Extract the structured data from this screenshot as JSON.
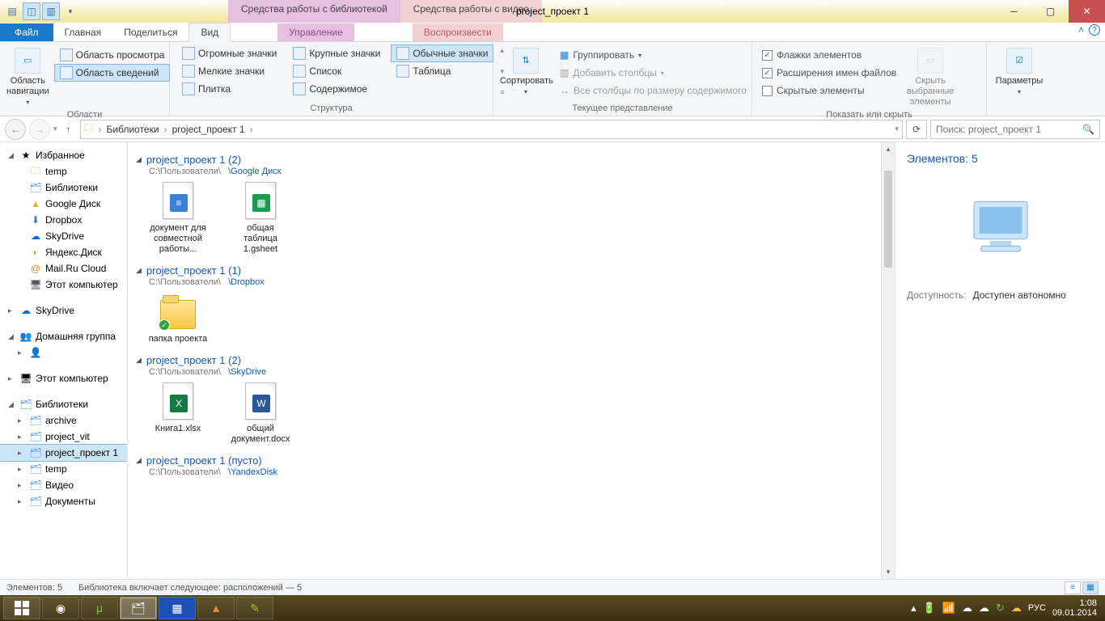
{
  "window": {
    "title": "project_проект 1",
    "ctx_tab1": "Средства работы с библиотекой",
    "ctx_tab2": "Средства работы с видео"
  },
  "ribbon_tabs": {
    "file": "Файл",
    "home": "Главная",
    "share": "Поделиться",
    "view": "Вид",
    "manage": "Управление",
    "play": "Воспроизвести"
  },
  "ribbon": {
    "panes": {
      "nav_pane": "Область навигации",
      "preview": "Область просмотра",
      "details": "Область сведений",
      "group": "Области"
    },
    "layout": {
      "xl_icons": "Огромные значки",
      "l_icons": "Крупные значки",
      "m_icons": "Обычные значки",
      "s_icons": "Мелкие значки",
      "list": "Список",
      "details": "Таблица",
      "tiles": "Плитка",
      "content": "Содержимое",
      "group": "Структура"
    },
    "view": {
      "sort": "Сортировать",
      "group_by": "Группировать",
      "add_cols": "Добавить столбцы",
      "size_cols": "Все столбцы по размеру содержимого",
      "group": "Текущее представление"
    },
    "show": {
      "checkboxes": "Флажки элементов",
      "extensions": "Расширения имен файлов",
      "hidden": "Скрытые элементы",
      "hide_sel": "Скрыть выбранные элементы",
      "group": "Показать или скрыть"
    },
    "options": {
      "label": "Параметры"
    }
  },
  "nav": {
    "crumb1": "Библиотеки",
    "crumb2": "project_проект 1",
    "search_ph": "Поиск: project_проект 1"
  },
  "tree": {
    "fav": "Избранное",
    "fav_items": [
      "temp",
      "Библиотеки",
      "Google Диск",
      "Dropbox",
      "SkyDrive",
      "Яндекс.Диск",
      "Mail.Ru Cloud",
      "Этот компьютер"
    ],
    "skydrive": "SkyDrive",
    "homegroup": "Домашняя группа",
    "this_pc": "Этот компьютер",
    "libs": "Библиотеки",
    "lib_items": [
      "archive",
      "project_vit",
      "project_проект 1",
      "temp",
      "Видео",
      "Документы"
    ]
  },
  "groups": [
    {
      "title": "project_проект 1 (2)",
      "path_a": "C:\\Пользователи\\",
      "path_b": "\\Google Диск",
      "items": [
        {
          "name": "документ для совместной работы...",
          "type": "gdoc"
        },
        {
          "name": "общая таблица 1.gsheet",
          "type": "gsheet"
        }
      ]
    },
    {
      "title": "project_проект 1 (1)",
      "path_a": "C:\\Пользователи\\",
      "path_b": "\\Dropbox",
      "items": [
        {
          "name": "папка проекта",
          "type": "folder"
        }
      ]
    },
    {
      "title": "project_проект 1 (2)",
      "path_a": "C:\\Пользователи\\",
      "path_b": "\\SkyDrive",
      "items": [
        {
          "name": "Книга1.xlsx",
          "type": "xlsx"
        },
        {
          "name": "общий документ.docx",
          "type": "docx"
        }
      ]
    },
    {
      "title": "project_проект 1 (пусто)",
      "path_a": "C:\\Пользователи\\",
      "path_b": "\\YandexDisk",
      "items": []
    }
  ],
  "details": {
    "heading": "Элементов: 5",
    "k1": "Доступность:",
    "v1": "Доступен автономно"
  },
  "status": {
    "count": "Элементов: 5",
    "lib": "Библиотека включает следующее: расположений — 5"
  },
  "taskbar": {
    "lang": "РУС",
    "time": "1:08",
    "date": "09.01.2014"
  }
}
